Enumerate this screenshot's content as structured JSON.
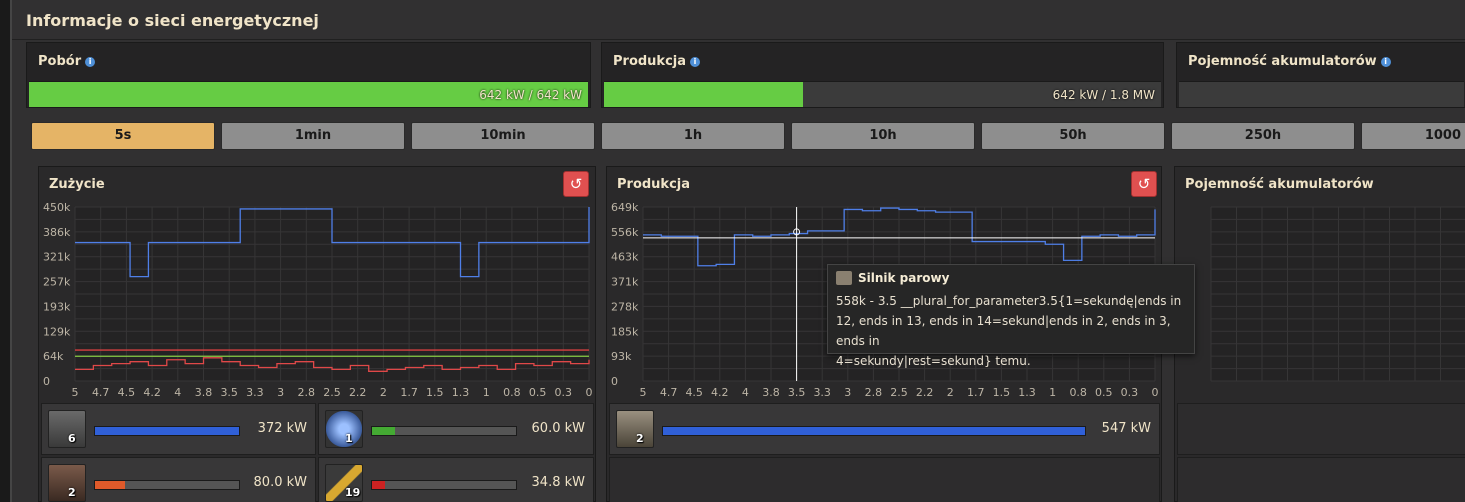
{
  "window": {
    "title": "Informacje o sieci energetycznej"
  },
  "stats": [
    {
      "label": "Pobór",
      "text": "642 kW / 642 kW",
      "fill": 1.0
    },
    {
      "label": "Produkcja",
      "text": "642 kW / 1.8 MW",
      "fill": 0.357
    },
    {
      "label": "Pojemność akumulatorów",
      "text": "",
      "fill": 0
    }
  ],
  "tabs": [
    "5s",
    "1min",
    "10min",
    "1h",
    "10h",
    "50h",
    "250h",
    "1000"
  ],
  "active_tab": "5s",
  "panels": {
    "consumption": {
      "title": "Zużycie"
    },
    "production": {
      "title": "Produkcja"
    },
    "accumulators": {
      "title": "Pojemność akumulatorów"
    }
  },
  "reset_icon": "↺",
  "chart_data": [
    {
      "type": "line",
      "title": "Zużycie",
      "x": [
        5,
        4.7,
        4.5,
        4.2,
        4,
        3.8,
        3.5,
        3.3,
        3,
        2.8,
        2.5,
        2.2,
        2,
        1.7,
        1.5,
        1.3,
        1,
        0.8,
        0.5,
        0.3,
        0
      ],
      "xticks": [
        "5",
        "4.7",
        "4.5",
        "4.2",
        "4",
        "3.8",
        "3.5",
        "3.3",
        "3",
        "2.8",
        "2.5",
        "2.2",
        "2",
        "1.7",
        "1.5",
        "1.3",
        "1",
        "0.8",
        "0.5",
        "0.3",
        "0"
      ],
      "yticks": [
        "0",
        "64k",
        "129k",
        "193k",
        "257k",
        "321k",
        "386k",
        "450k"
      ],
      "ylim": [
        0,
        450
      ],
      "series": [
        {
          "color": "#4f7fe8",
          "values": [
            358,
            358,
            358,
            270,
            358,
            358,
            358,
            358,
            358,
            445,
            445,
            445,
            445,
            445,
            358,
            358,
            358,
            358,
            358,
            358,
            358,
            270,
            358,
            358,
            358,
            358,
            358,
            358,
            450
          ]
        },
        {
          "color": "#e04848",
          "values": [
            30,
            40,
            45,
            50,
            40,
            55,
            45,
            60,
            50,
            40,
            35,
            45,
            50,
            35,
            30,
            40,
            25,
            30,
            35,
            40,
            30,
            35,
            40,
            30,
            45,
            40,
            50,
            45,
            55
          ]
        },
        {
          "color": "#d84040",
          "values": [
            80,
            80
          ]
        },
        {
          "color": "#88cc44",
          "values": [
            64,
            64
          ]
        }
      ]
    },
    {
      "type": "line",
      "title": "Produkcja",
      "x": [
        5,
        4.7,
        4.5,
        4.2,
        4,
        3.8,
        3.5,
        3.3,
        3,
        2.8,
        2.5,
        2.2,
        2,
        1.7,
        1.5,
        1.3,
        1,
        0.8,
        0.5,
        0.3,
        0
      ],
      "xticks": [
        "5",
        "4.7",
        "4.5",
        "4.2",
        "4",
        "3.8",
        "3.5",
        "3.3",
        "3",
        "2.8",
        "2.5",
        "2.2",
        "2",
        "1.7",
        "1.5",
        "1.3",
        "1",
        "0.8",
        "0.5",
        "0.3",
        "0"
      ],
      "yticks": [
        "0",
        "93k",
        "185k",
        "278k",
        "371k",
        "463k",
        "556k",
        "649k"
      ],
      "ylim": [
        0,
        649
      ],
      "series": [
        {
          "color": "#4f7fe8",
          "values": [
            545,
            540,
            540,
            430,
            435,
            545,
            540,
            545,
            550,
            560,
            560,
            640,
            635,
            645,
            640,
            635,
            630,
            630,
            520,
            520,
            520,
            520,
            510,
            450,
            540,
            545,
            540,
            545,
            640
          ]
        }
      ],
      "cursor_x": 3.5,
      "cursor_y": 556
    }
  ],
  "consumers": [
    {
      "count": "6",
      "value": "372 kW",
      "fill": 1.0,
      "color": "#3060d8",
      "icon": "assembling-machine-icon"
    },
    {
      "count": "1",
      "value": "60.0 kW",
      "fill": 0.16,
      "color": "#44aa33",
      "icon": "lab-icon"
    },
    {
      "count": "2",
      "value": "80.0 kW",
      "fill": 0.21,
      "color": "#e05a2a",
      "icon": "electric-furnace-icon"
    },
    {
      "count": "19",
      "value": "34.8 kW",
      "fill": 0.09,
      "color": "#cc2222",
      "icon": "inserter-icon"
    }
  ],
  "producers": [
    {
      "count": "2",
      "value": "547 kW",
      "fill": 1.0,
      "color": "#3060d8",
      "icon": "steam-engine-icon"
    }
  ],
  "tooltip": {
    "title": "Silnik parowy",
    "line1": "558k - 3.5 __plural_for_parameter3.5{1=sekundę|ends in",
    "line2": "12, ends in 13, ends in 14=sekund|ends in 2, ends in 3, ends in",
    "line3": "4=sekundy|rest=sekund} temu."
  }
}
